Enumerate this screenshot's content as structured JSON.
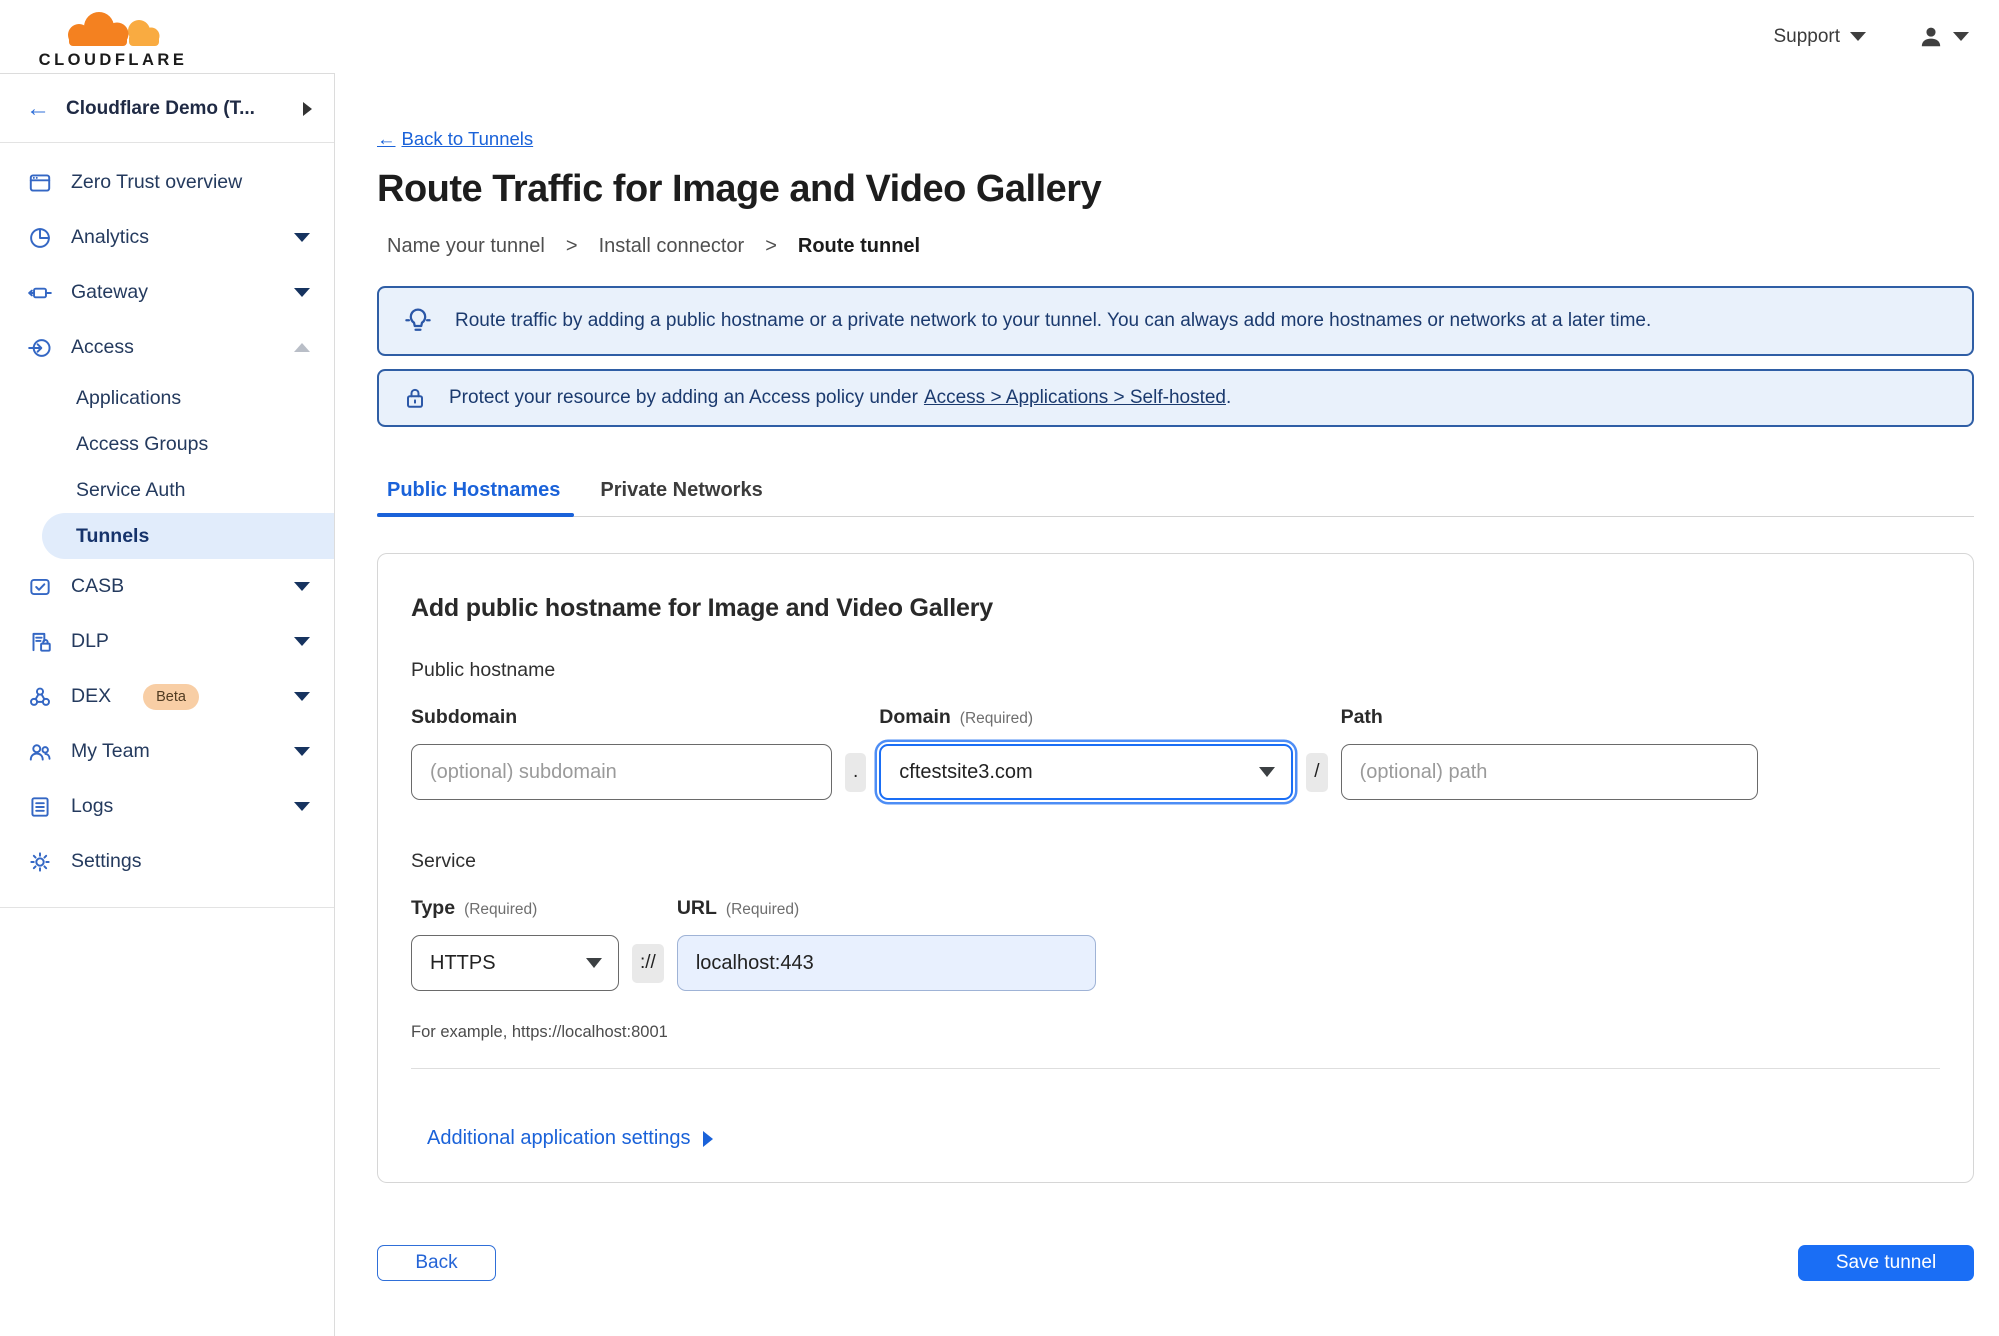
{
  "colors": {
    "brand_orange": "#f48120",
    "brand_orange_light": "#f9ab41",
    "accent_blue": "#1a62d9",
    "primary_button_blue": "#1a6ef5",
    "banner_border": "#2f5ea5",
    "banner_bg": "#e9f1fb",
    "selected_nav_bg": "#e1ecfb",
    "url_field_bg": "#e8f0fe"
  },
  "header": {
    "logo_text": "CLOUDFLARE",
    "support_label": "Support"
  },
  "sidebar": {
    "back_arrow": "←",
    "account_name": "Cloudflare Demo (T...",
    "nav": [
      {
        "label": "Zero Trust overview",
        "icon": "window-icon"
      },
      {
        "label": "Analytics",
        "icon": "pie-chart-icon"
      },
      {
        "label": "Gateway",
        "icon": "gateway-icon"
      },
      {
        "label": "Access",
        "icon": "access-login-icon"
      },
      {
        "label": "CASB",
        "icon": "cloud-check-icon"
      },
      {
        "label": "DLP",
        "icon": "document-lock-icon"
      },
      {
        "label": "DEX",
        "icon": "network-nodes-icon",
        "badge": "Beta"
      },
      {
        "label": "My Team",
        "icon": "people-icon"
      },
      {
        "label": "Logs",
        "icon": "log-list-icon"
      },
      {
        "label": "Settings",
        "icon": "gear-icon"
      }
    ],
    "access_subitems": [
      {
        "label": "Applications"
      },
      {
        "label": "Access Groups"
      },
      {
        "label": "Service Auth"
      },
      {
        "label": "Tunnels",
        "selected": true
      }
    ]
  },
  "main": {
    "back_link": {
      "arrow": "←",
      "label": "Back to Tunnels"
    },
    "title": "Route Traffic for Image and Video Gallery",
    "steps": {
      "separator": ">",
      "items": [
        {
          "label": "Name your tunnel"
        },
        {
          "label": "Install connector"
        },
        {
          "label": "Route tunnel",
          "current": true
        }
      ]
    },
    "banners": {
      "tip": "Route traffic by adding a public hostname or a private network to your tunnel. You can always add more hostnames or networks at a later time.",
      "protect_prefix": "Protect your resource by adding an Access policy under",
      "protect_link": "Access > Applications > Self-hosted",
      "protect_suffix": "."
    },
    "tabs": [
      {
        "label": "Public Hostnames",
        "active": true
      },
      {
        "label": "Private Networks",
        "active": false
      }
    ],
    "form": {
      "heading": "Add public hostname for Image and Video Gallery",
      "group_label": "Public hostname",
      "required_hint": "(Required)",
      "subdomain_label": "Subdomain",
      "subdomain_placeholder": "(optional) subdomain",
      "dot_separator": ".",
      "domain_label": "Domain",
      "domain_value": "cftestsite3.com",
      "slash_separator": "/",
      "path_label": "Path",
      "path_placeholder": "(optional) path",
      "service_label": "Service",
      "type_label": "Type",
      "type_value": "HTTPS",
      "scheme_separator": "://",
      "url_label": "URL",
      "url_value": "localhost:443",
      "url_example": "For example, https://localhost:8001",
      "additional_settings": "Additional application settings"
    },
    "footer": {
      "back_label": "Back",
      "save_label": "Save tunnel"
    }
  }
}
